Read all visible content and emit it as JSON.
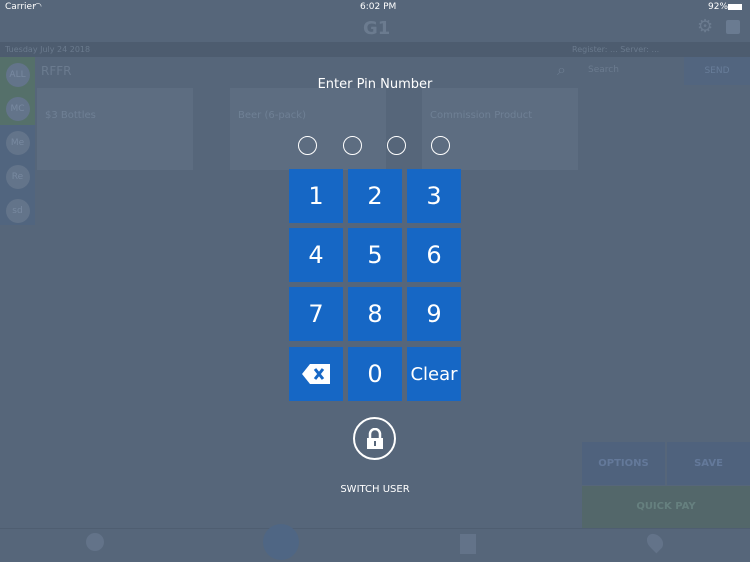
{
  "status": {
    "carrier": "Carrier",
    "time": "6:02 PM",
    "battery": "92%"
  },
  "header": {
    "logo": "G1",
    "date": "Tuesday July 24 2018",
    "register_info": "Register: ... Server: ..."
  },
  "search": {
    "order_label": "RFFR",
    "placeholder": "Search",
    "send": "SEND"
  },
  "sidebar": {
    "items": [
      "ALL",
      "MC",
      "Me",
      "Re",
      "sd"
    ]
  },
  "products": [
    {
      "name": "$3 Bottles"
    },
    {
      "name": "Beer (6-pack)"
    },
    {
      "name": "Commission Product"
    }
  ],
  "actions": {
    "options": "OPTIONS",
    "save": "SAVE",
    "quick_pay": "QUICK PAY"
  },
  "pin": {
    "title": "Enter Pin Number",
    "digits_entered": 0,
    "digits_total": 4,
    "keys": [
      "1",
      "2",
      "3",
      "4",
      "5",
      "6",
      "7",
      "8",
      "9",
      "backspace",
      "0",
      "Clear"
    ],
    "switch_user": "SWITCH USER"
  },
  "colors": {
    "key": "#1667c5",
    "overlay": "#56667a"
  }
}
